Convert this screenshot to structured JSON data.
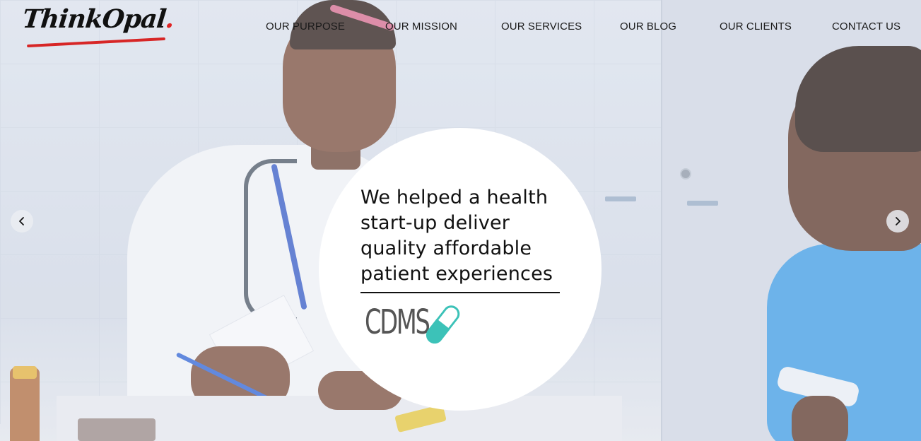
{
  "brand": {
    "logo_text": "ThinkOpal",
    "logo_dot": ".",
    "accent_color": "#e02424"
  },
  "nav": {
    "items": [
      {
        "label": "OUR PURPOSE"
      },
      {
        "label": "OUR MISSION"
      },
      {
        "label": "OUR SERVICES"
      },
      {
        "label": "OUR BLOG"
      },
      {
        "label": "OUR CLIENTS"
      },
      {
        "label": "CONTACT US"
      }
    ]
  },
  "hero": {
    "headline_lines": [
      "We helped a health",
      "start-up deliver",
      "quality affordable",
      "patient experiences"
    ],
    "client_logo_text": "CDMS",
    "client_logo_color": "#3cc2b8",
    "prev_icon": "chevron-left-icon",
    "next_icon": "chevron-right-icon"
  }
}
